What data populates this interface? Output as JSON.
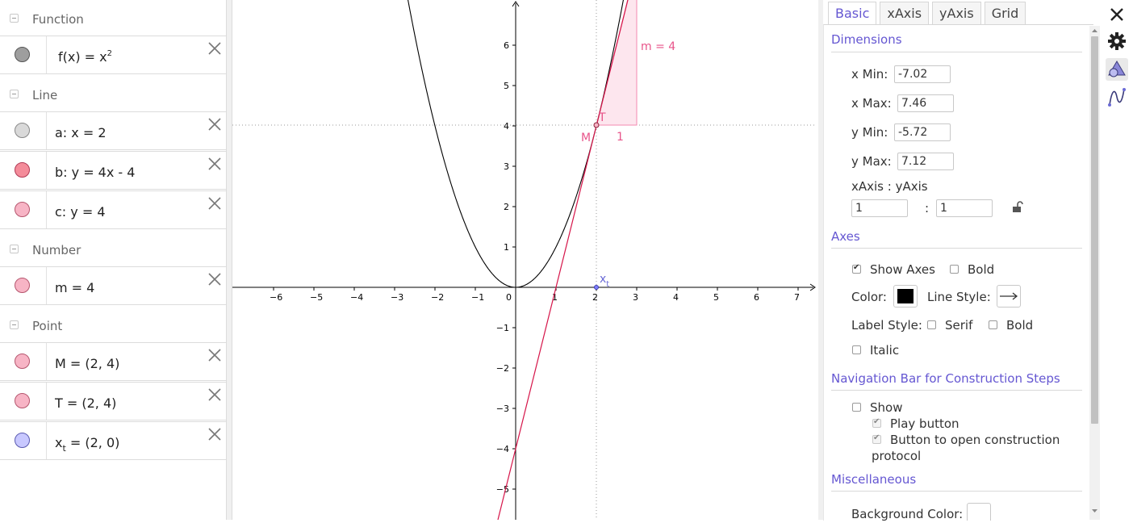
{
  "algebra": {
    "groups": [
      {
        "title": "Function",
        "items": [
          {
            "label_pre": "f(x)  =  x",
            "label_sup": "2",
            "color": "#9e9e9e"
          }
        ]
      },
      {
        "title": "Line",
        "items": [
          {
            "label": "a: x  =  2",
            "color": "#d9d9d9"
          },
          {
            "label": "b: y  =  4x - 4",
            "color": "#f48c9a"
          },
          {
            "label": "c: y  =  4",
            "color": "#f7b4c5"
          }
        ]
      },
      {
        "title": "Number",
        "items": [
          {
            "label": "m  =  4",
            "color": "#f7b4c5"
          }
        ]
      },
      {
        "title": "Point",
        "items": [
          {
            "label": "M  =  (2, 4)",
            "color": "#f7b4c5"
          },
          {
            "label": "T  =  (2, 4)",
            "color": "#f7b4c5"
          },
          {
            "label_pre": "x",
            "label_sub": "t",
            "label_post": "  =  (2, 0)",
            "color": "#c8c8ff"
          }
        ]
      }
    ]
  },
  "graphics": {
    "x_ticks": [
      "−6",
      "−5",
      "−4",
      "−3",
      "−2",
      "−1",
      "0",
      "1",
      "2",
      "3",
      "4",
      "5",
      "6",
      "7"
    ],
    "y_ticks_pos": [
      "1",
      "2",
      "3",
      "4",
      "5",
      "6"
    ],
    "y_ticks_neg": [
      "−1",
      "−2",
      "−3",
      "−4",
      "−5"
    ],
    "label_m": "m = 4",
    "label_one": "1",
    "label_T": "T",
    "label_M": "M",
    "label_xt": "x",
    "label_xt_sub": "t",
    "colors": {
      "tangent": "#d6164a",
      "triangle_fill": "#fde6ee",
      "triangle_stroke": "#f48ab0",
      "text_pink": "#e8548a",
      "point_xt": "#6a6ad6"
    }
  },
  "properties": {
    "tabs": [
      "Basic",
      "xAxis",
      "yAxis",
      "Grid"
    ],
    "dimensions": {
      "title": "Dimensions",
      "xmin_label": "x Min:",
      "xmin": "-7.02",
      "xmax_label": "x Max:",
      "xmax": "7.46",
      "ymin_label": "y Min:",
      "ymin": "-5.72",
      "ymax_label": "y Max:",
      "ymax": "7.12",
      "ratio_label": "xAxis : yAxis",
      "ratio_x": "1",
      "ratio_sep": ":",
      "ratio_y": "1"
    },
    "axes": {
      "title": "Axes",
      "show_axes": "Show Axes",
      "bold": "Bold",
      "color_label": "Color:",
      "line_style_label": "Line Style:",
      "label_style": "Label Style:",
      "serif": "Serif",
      "bold2": "Bold",
      "italic": "Italic",
      "axis_color": "#000000"
    },
    "navigation": {
      "title": "Navigation Bar for Construction Steps",
      "show": "Show",
      "play_button": "Play button",
      "open_protocol_line1": "Button to open construction",
      "open_protocol_line2": "protocol"
    },
    "misc": {
      "title": "Miscellaneous",
      "background_color": "Background Color:"
    }
  }
}
